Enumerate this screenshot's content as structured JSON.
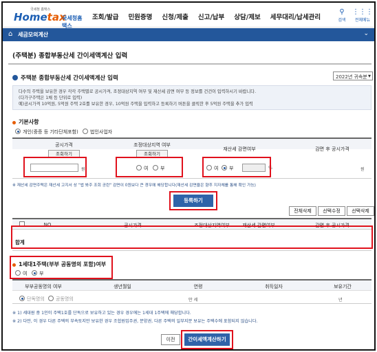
{
  "header": {
    "logo_sub": "국세청 홈택스",
    "logo_main_a": "Home",
    "logo_main_b": "tax",
    "logo_kr": "국세청홈택스",
    "nav": [
      "조회/발급",
      "민원증명",
      "신청/제출",
      "신고/납부",
      "상담/제보",
      "세무대리/납세관리"
    ],
    "search_label": "검색",
    "menu_label": "전체메뉴"
  },
  "bar": {
    "title": "세금모의계산"
  },
  "page": {
    "title": "(주택분) 종합부동산세 간이세액계산 입력",
    "section_title": "주택분 종합부동산세 간이세액계산 입력",
    "year_select": "2022년 귀속분",
    "notice": [
      "다수의 주택을 보유한 경우 각각 주택별로 공시가격, 조정대상지역 여부 및 재산세 감면 여부 등 정보를 건건이 입력하시기 바랍니다.",
      "(다가구주택은 1채 등 단위로 입력)",
      "예)공시가격 10억원, 5억원 주택 2호를 보유한 경우, 10억원 주택을 입력하고 등록하기 버튼을 클릭한 후 5억원 주택을 추가 입력"
    ]
  },
  "basic": {
    "title": "기본사항",
    "opt_individual": "개인(중증 등 기타단체포함)",
    "opt_corp": "법인사업자"
  },
  "input_table": {
    "h_price": "공시가격",
    "btn_price": "조회하기",
    "unit_won": "원",
    "h_adjust": "조정대상지역 여부",
    "btn_adjust": "조회하기",
    "opt_yes": "여",
    "opt_no": "부",
    "h_reduce": "재산세 감면여부",
    "unit_pct": "%",
    "h_after": "감면 후 공시가격",
    "after_unit": "원",
    "note": "※ 재산세 감면주택은 재산세 고지서 상 \"법 봐주 조회 공란\" 감면이 0원보다 큰 경우에 해당합니다(재산세 감면율은 향후 지자체를 통해 확인 가능)"
  },
  "register_btn": "등록하기",
  "list_btns": [
    "전체삭제",
    "선택수정",
    "선택삭제"
  ],
  "list_table": {
    "headers": [
      "NO",
      "공시가격",
      "조정대상지역여부",
      "재산세 감면여부",
      "감면 후 공시가격"
    ],
    "total_label": "합계"
  },
  "one_house": {
    "title": "1세대1주택(부부 공동명의 포함)여부",
    "opt_yes": "여",
    "opt_no": "부"
  },
  "detail_table": {
    "headers": [
      "부부공동명의 여부",
      "생년월일",
      "연령",
      "취득일자",
      "보유기간"
    ],
    "opt_single": "단독명의",
    "opt_joint": "공동명의",
    "age_unit": "만 세",
    "hold_unit": "년"
  },
  "footnotes": [
    "※ 1) 세대원 중 1인이 주택1호를 단독으로 보유하고 있는 경우 경우에는 1세대 1주택에 해당합니다.",
    "※ 2) 다만, 이 경우 다른 주택의 부속토지만 보유한 경우 조합원입주권, 분양권, 다른 주택의 일부지분 보유는 주택수에 포함되지 않습니다."
  ],
  "prev_btn": "이전",
  "calc_btn": "간이세액계산하기"
}
